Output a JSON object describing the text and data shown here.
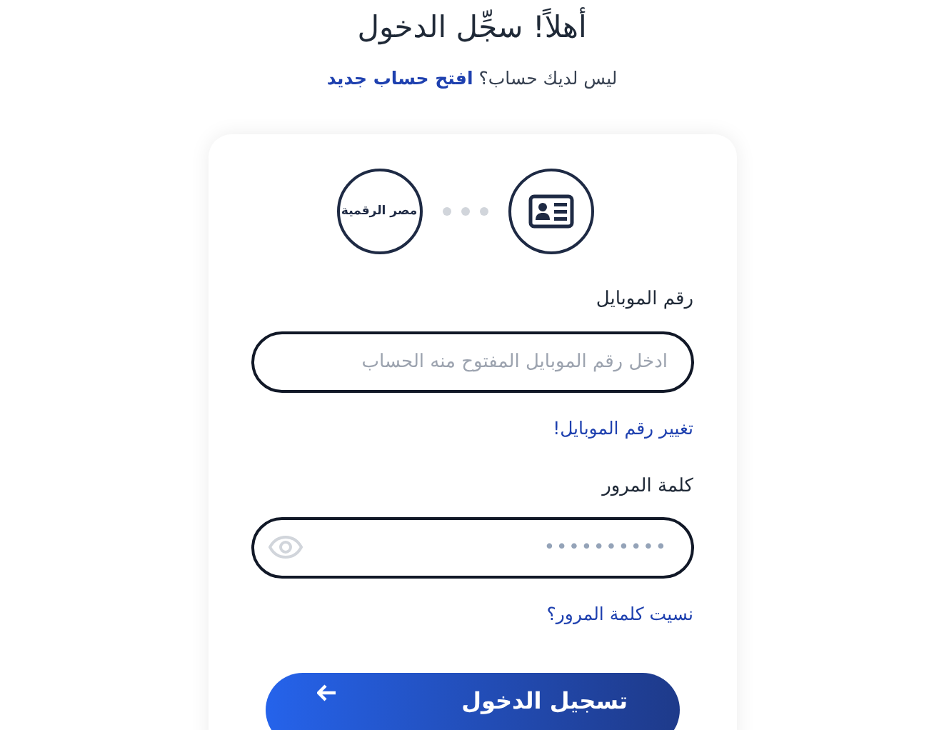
{
  "heading": "أهلاً! سجِّل الدخول",
  "signup": {
    "prompt": "ليس لديك حساب؟",
    "link": "افتح حساب جديد"
  },
  "steps": {
    "logo": "مصر الرقمية"
  },
  "fields": [
    {
      "kind": "text",
      "label": "رقم الموبايل",
      "placeholder": "ادخل رقم الموبايل المفتوح منه الحساب",
      "link": "تغيير رقم الموبايل!"
    },
    {
      "kind": "password",
      "label": "كلمة المرور",
      "value": "••••••••••",
      "link": "نسيت كلمة المرور؟"
    }
  ],
  "submit": "تسجيل الدخول"
}
